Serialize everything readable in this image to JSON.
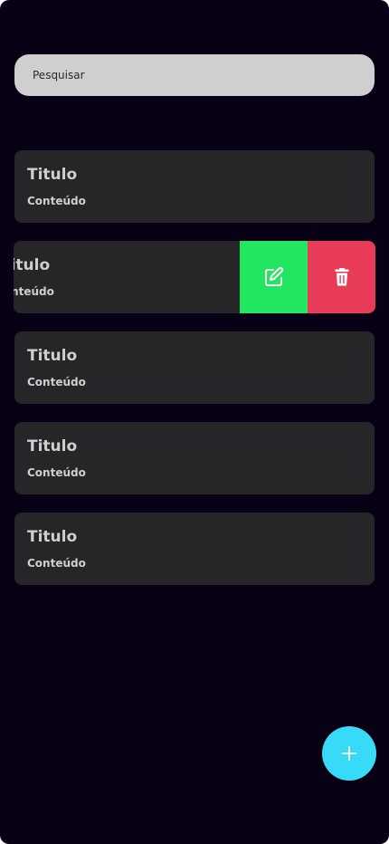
{
  "search": {
    "placeholder": "Pesquisar"
  },
  "notes": [
    {
      "title": "Titulo",
      "content": "Conteúdo"
    },
    {
      "title": "Titulo",
      "content": "Conteúdo"
    },
    {
      "title": "Titulo",
      "content": "Conteúdo"
    },
    {
      "title": "Titulo",
      "content": "Conteúdo"
    },
    {
      "title": "Titulo",
      "content": "Conteúdo"
    }
  ],
  "swipe_actions": {
    "edit_icon": "edit-icon",
    "delete_icon": "trash-icon",
    "edit_color": "#22e561",
    "delete_color": "#e83b57"
  },
  "fab": {
    "icon": "plus-icon",
    "color": "#38dbf7"
  },
  "colors": {
    "background": "#080014",
    "card": "#262629",
    "search": "#cfcfcf",
    "text": "#cfcfcf"
  }
}
